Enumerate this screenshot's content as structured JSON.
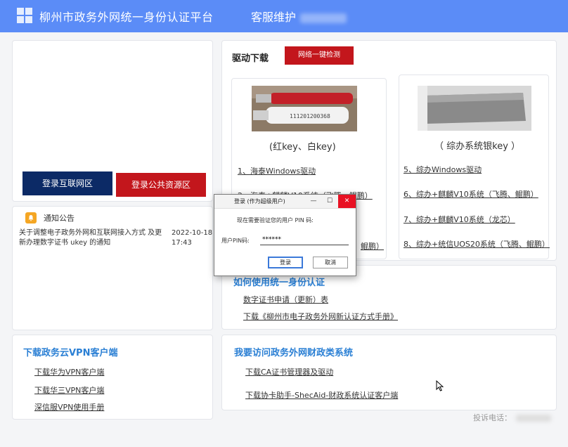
{
  "header": {
    "title": "柳州市政务外网统一身份认证平台",
    "support_label": "客服维护"
  },
  "login": {
    "internet_button": "登录互联网区",
    "public_resource_button": "登录公共资源区"
  },
  "notice": {
    "title": "通知公告",
    "items": [
      {
        "text": "关于调整电子政务外网和互联网接入方式 及更新办理数字证书 ukey 的通知",
        "date": "2022-10-18 17:43"
      }
    ]
  },
  "driver": {
    "title": "驱动下载",
    "check_button": "网络一键检测",
    "cards": [
      {
        "caption": "(红key、白key)",
        "key_print": "111201200368",
        "links": [
          "1、海泰Windows驱动",
          "2、海泰+麒麟V10系统（飞腾、鲲鹏）",
          "鲲鹏）"
        ]
      },
      {
        "caption": "（ 综办系统银key ）",
        "links": [
          "5、综办Windows驱动",
          "6、综办+麒麟V10系统（飞腾、鲲鹏）",
          "7、综办+麒麟V10系统（龙芯）",
          "8、综办+统信UOS20系统（飞腾、鲲鹏）"
        ]
      }
    ]
  },
  "how_to": {
    "title": "如何使用统一身份认证",
    "links": [
      "数字证书申请（更新）表",
      "下载《柳州市电子政务外网新认证方式手册》"
    ]
  },
  "vpn": {
    "title": "下载政务云VPN客户端",
    "links": [
      "下载华为VPN客户端",
      "下载华三VPN客户端",
      "深信服VPN使用手册"
    ]
  },
  "finance": {
    "title": "我要访问政务外网财政类系统",
    "links": [
      "下载CA证书管理器及驱动",
      "下载协卡助手-ShecAid-财政系统认证客户端"
    ]
  },
  "footer": {
    "complaint_label": "投诉电话："
  },
  "dialog": {
    "title": "登录 (作为超级用户)",
    "message": "现在需要验证您的用户 PIN 码:",
    "pin_label": "用户PIN码:",
    "pin_value": "******",
    "ok_button": "登录",
    "cancel_button": "取消"
  },
  "colors": {
    "header": "#5b8cf7",
    "navy_button": "#0c2a66",
    "red_button": "#c3161c",
    "blue_title": "#2a7fd4"
  }
}
